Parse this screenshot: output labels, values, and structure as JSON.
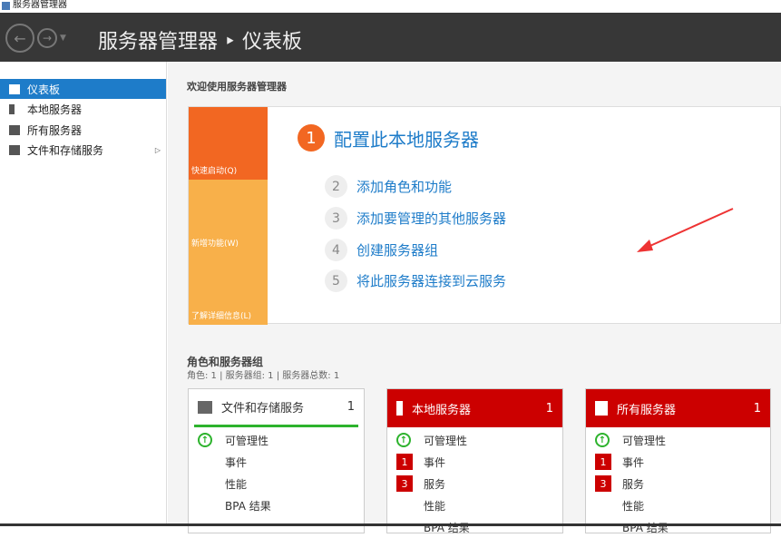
{
  "window": {
    "title": "服务器管理器"
  },
  "header": {
    "breadcrumb": "服务器管理器 ‣ 仪表板"
  },
  "sidebar": {
    "items": [
      {
        "label": "仪表板"
      },
      {
        "label": "本地服务器"
      },
      {
        "label": "所有服务器"
      },
      {
        "label": "文件和存储服务"
      }
    ]
  },
  "main": {
    "welcome": "欢迎使用服务器管理器",
    "tiles": [
      {
        "label": "快速启动(Q)",
        "color": "#f26722"
      },
      {
        "label": "新增功能(W)",
        "color": "#f8b04a"
      },
      {
        "label": "了解详细信息(L)",
        "color": "#f8b04a"
      }
    ],
    "steps": [
      {
        "n": "1",
        "label": "配置此本地服务器"
      },
      {
        "n": "2",
        "label": "添加角色和功能"
      },
      {
        "n": "3",
        "label": "添加要管理的其他服务器"
      },
      {
        "n": "4",
        "label": "创建服务器组"
      },
      {
        "n": "5",
        "label": "将此服务器连接到云服务"
      }
    ],
    "roles_title": "角色和服务器组",
    "roles_sub": "角色: 1 | 服务器组: 1 | 服务器总数: 1",
    "cards": [
      {
        "title": "文件和存储服务",
        "count": "1",
        "rows": [
          {
            "label": "可管理性"
          },
          {
            "label": "事件"
          },
          {
            "label": "性能"
          },
          {
            "label": "BPA 结果"
          }
        ]
      },
      {
        "title": "本地服务器",
        "count": "1",
        "rows": [
          {
            "label": "可管理性"
          },
          {
            "badge": "1",
            "label": "事件"
          },
          {
            "badge": "3",
            "label": "服务"
          },
          {
            "label": "性能"
          },
          {
            "label": "BPA 结果"
          }
        ]
      },
      {
        "title": "所有服务器",
        "count": "1",
        "rows": [
          {
            "label": "可管理性"
          },
          {
            "badge": "1",
            "label": "事件"
          },
          {
            "badge": "3",
            "label": "服务"
          },
          {
            "label": "性能"
          },
          {
            "label": "BPA 结果"
          }
        ]
      }
    ]
  }
}
